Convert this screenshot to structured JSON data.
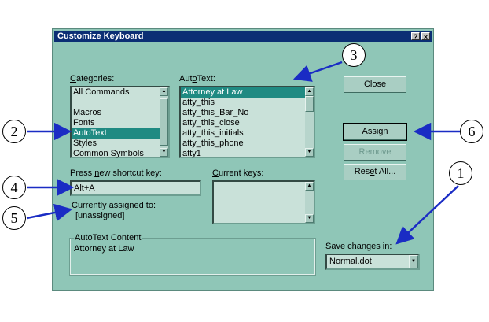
{
  "dialog": {
    "title": "Customize Keyboard",
    "help_button": "?",
    "close_button": "×"
  },
  "categories": {
    "label_pre": "",
    "label_u": "C",
    "label_post": "ategories:",
    "items": [
      "All Commands",
      "Macros",
      "Fonts",
      "AutoText",
      "Styles",
      "Common Symbols"
    ],
    "selected": "AutoText"
  },
  "autotext": {
    "label_pre": "Aut",
    "label_u": "o",
    "label_post": "Text:",
    "items": [
      "Attorney at Law",
      "atty_this",
      "atty_this_Bar_No",
      "atty_this_close",
      "atty_this_initials",
      "atty_this_phone",
      "atty1"
    ],
    "selected": "Attorney at Law"
  },
  "buttons": {
    "close": "Close",
    "assign_u": "A",
    "assign_post": "ssign",
    "remove": "Remove",
    "reset_pre": "Res",
    "reset_u": "e",
    "reset_post": "t All..."
  },
  "shortcut": {
    "label_pre": "Press ",
    "label_u": "n",
    "label_post": "ew shortcut key:",
    "value": "Alt+A"
  },
  "current_keys": {
    "label_u": "C",
    "label_post": "urrent keys:"
  },
  "assigned": {
    "label": "Currently assigned to:",
    "value": "[unassigned]"
  },
  "content": {
    "legend": "AutoText Content",
    "text": "Attorney at Law"
  },
  "save": {
    "label_pre": "Sa",
    "label_u": "v",
    "label_post": "e changes in:",
    "value": "Normal.dot"
  },
  "callouts": [
    "1",
    "2",
    "3",
    "4",
    "5",
    "6"
  ],
  "colors": {
    "dialog_bg": "#8fc6b7",
    "titlebar": "#0b2e74",
    "selection": "#1f8a82",
    "arrow": "#1a2cc4"
  }
}
